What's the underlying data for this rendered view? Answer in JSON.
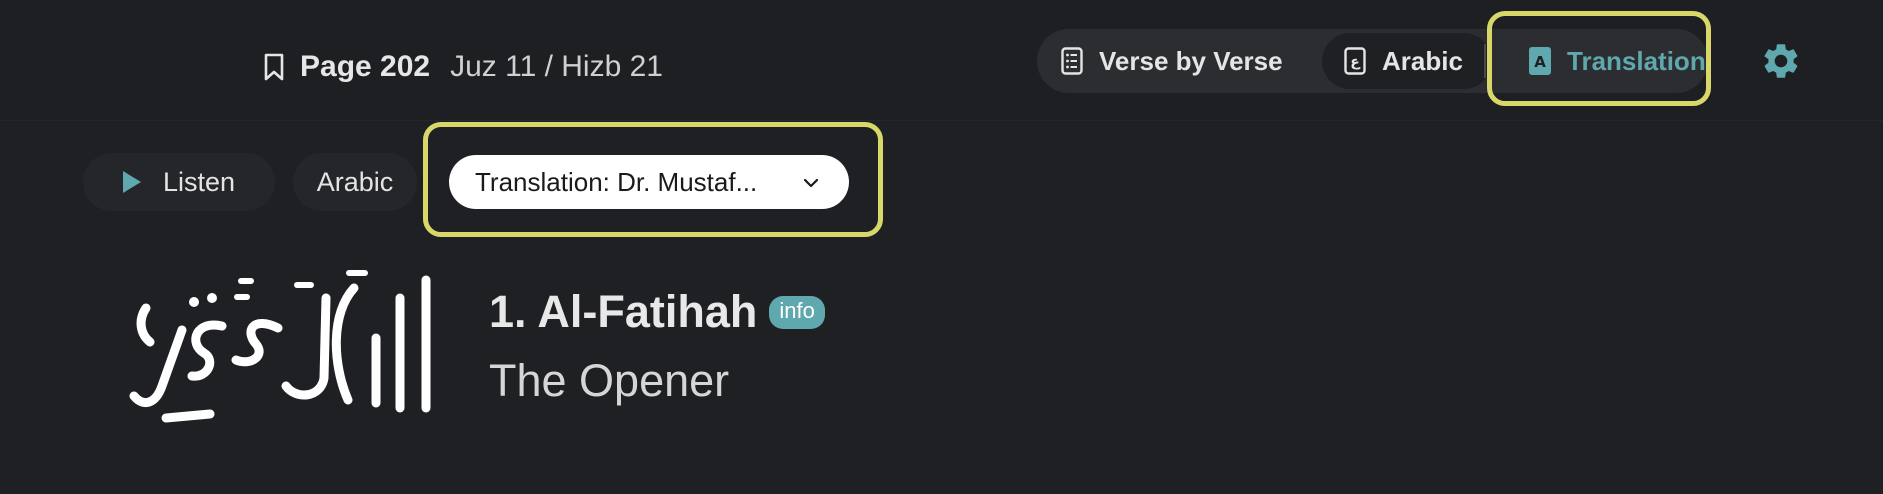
{
  "header": {
    "page_label": "Page 202",
    "juz_hizb": "Juz 11 / Hizb 21"
  },
  "modes": {
    "verse_by_verse": "Verse by Verse",
    "arabic": "Arabic",
    "translation": "Translation",
    "arabic_icon_glyph": "ع",
    "translation_icon_glyph": "A"
  },
  "controls": {
    "listen": "Listen",
    "arabic": "Arabic",
    "translation_select": "Translation: Dr. Mustaf..."
  },
  "surah": {
    "title": "1. Al-Fatihah",
    "info_badge": "info",
    "translated_name": "The Opener",
    "calligraphy_text": "الفاتحة"
  },
  "colors": {
    "accent": "#5fa8ae",
    "highlight": "#d8d86a",
    "background": "#1f2023"
  },
  "icons": {
    "bookmark": "bookmark-icon",
    "list": "list-icon",
    "arabic": "arabic-letter-icon",
    "translation": "translation-letter-icon",
    "settings": "gear-icon",
    "play": "play-icon",
    "dropdown": "chevron-down-icon"
  }
}
